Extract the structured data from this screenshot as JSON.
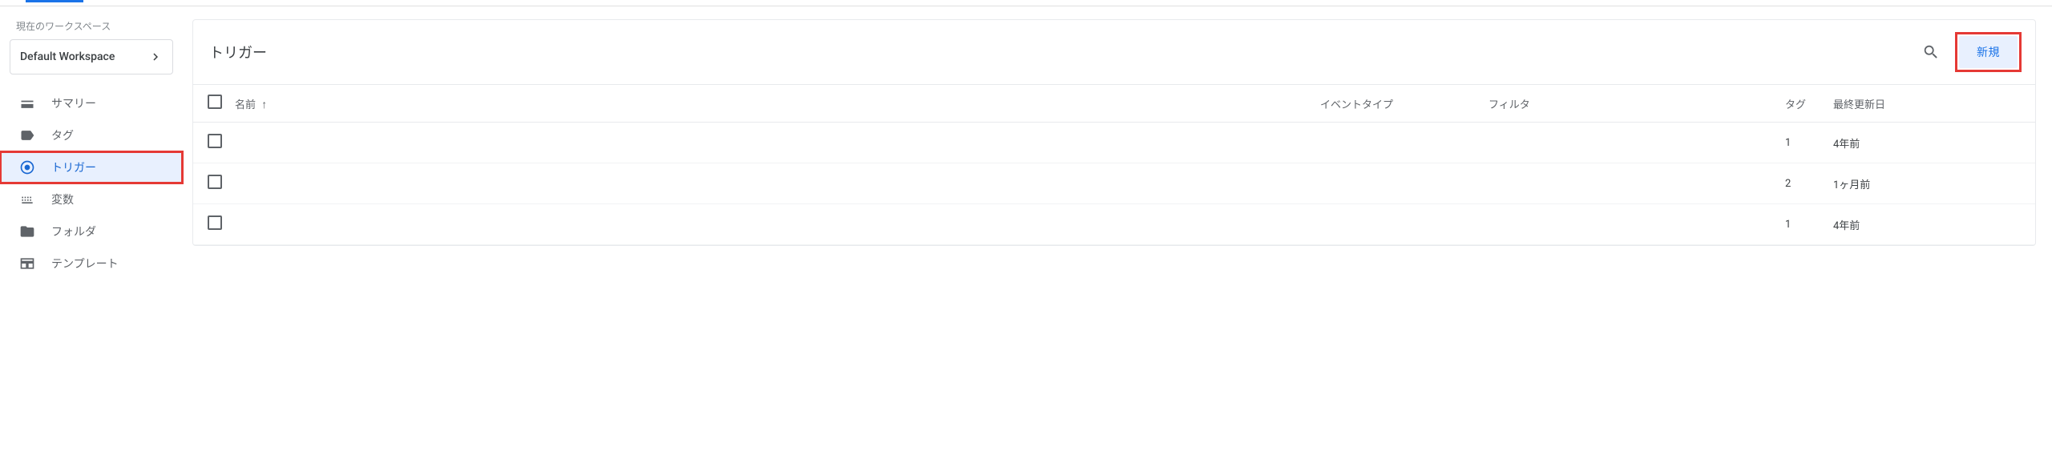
{
  "workspace": {
    "label": "現在のワークスペース",
    "name": "Default Workspace"
  },
  "nav": {
    "summary": "サマリー",
    "tags": "タグ",
    "triggers": "トリガー",
    "variables": "変数",
    "folders": "フォルダ",
    "templates": "テンプレート"
  },
  "card": {
    "title": "トリガー",
    "new_button": "新規"
  },
  "table": {
    "headers": {
      "name": "名前",
      "event_type": "イベントタイプ",
      "filter": "フィルタ",
      "tag": "タグ",
      "updated": "最終更新日"
    },
    "rows": [
      {
        "name": "",
        "event_type": "",
        "filter": "",
        "tag": "1",
        "updated": "4年前"
      },
      {
        "name": "",
        "event_type": "",
        "filter": "",
        "tag": "2",
        "updated": "1ヶ月前"
      },
      {
        "name": "",
        "event_type": "",
        "filter": "",
        "tag": "1",
        "updated": "4年前"
      }
    ]
  }
}
